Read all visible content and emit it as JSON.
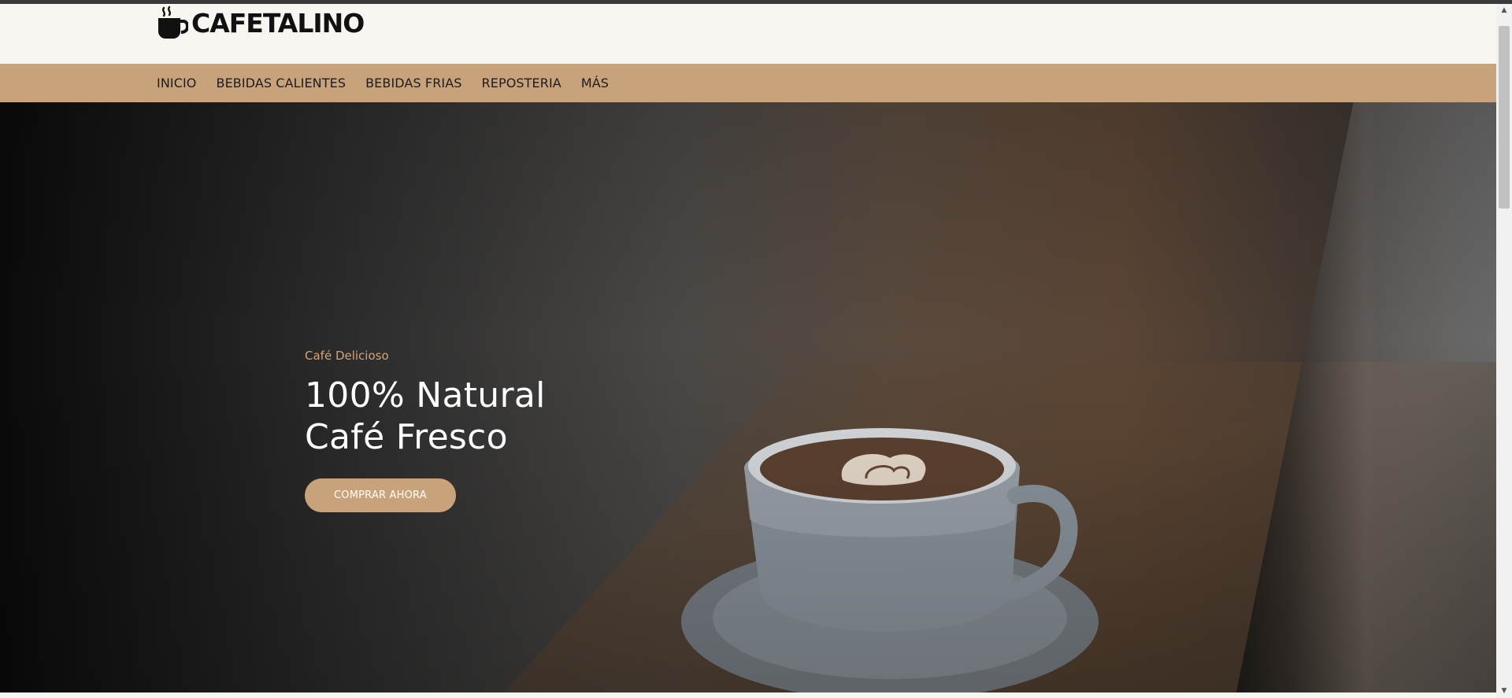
{
  "brand": {
    "name": "CAFETALINO",
    "icon": "coffee-cup-icon"
  },
  "nav": {
    "items": [
      {
        "label": "INICIO"
      },
      {
        "label": "BEBIDAS CALIENTES"
      },
      {
        "label": "BEBIDAS FRIAS"
      },
      {
        "label": "REPOSTERIA"
      },
      {
        "label": "MÁS"
      }
    ]
  },
  "hero": {
    "subtitle": "Café Delicioso",
    "title_line1": "100% Natural",
    "title_line2": "Café Fresco",
    "cta_label": "COMPRAR AHORA",
    "image": "latte-cup-on-wooden-table"
  },
  "colors": {
    "accent": "#c8a27a",
    "subtitle": "#d3a37a",
    "header_bg": "#f9f6f1",
    "text_dark": "#111111"
  },
  "scrollbar": {
    "up_icon": "triangle-up-icon",
    "down_icon": "triangle-down-icon"
  }
}
